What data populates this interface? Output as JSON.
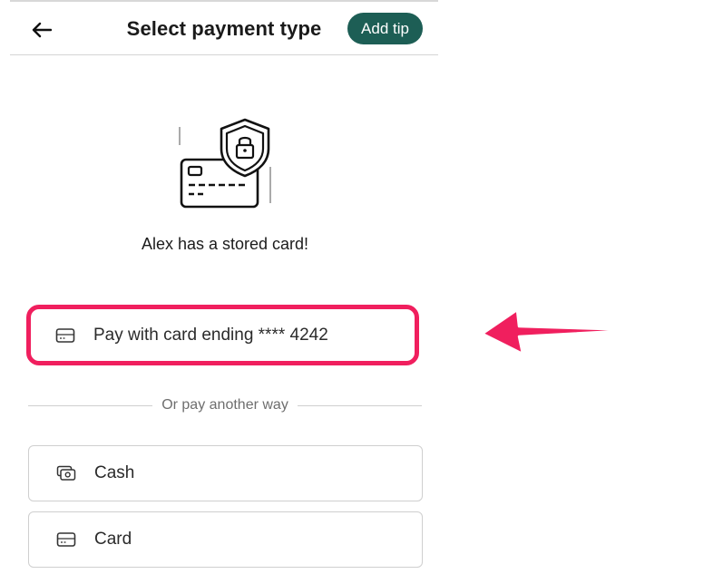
{
  "header": {
    "title": "Select payment type",
    "tip_button_label": "Add tip"
  },
  "stored_card": {
    "message": "Alex has a stored card!",
    "option_label": "Pay with card ending **** 4242"
  },
  "divider_text": "Or pay another way",
  "payment_options": [
    {
      "label": "Cash",
      "icon": "cash-icon"
    },
    {
      "label": "Card",
      "icon": "credit-card-icon"
    }
  ],
  "colors": {
    "accent_green": "#1d5e55",
    "highlight_pink": "#f01f5e",
    "border_gray": "#cfcfcf"
  },
  "icons": {
    "back": "arrow-left-icon",
    "illustration": "secure-card-shield-icon",
    "stored_card": "credit-card-icon",
    "annotation": "pointer-arrow-icon"
  }
}
